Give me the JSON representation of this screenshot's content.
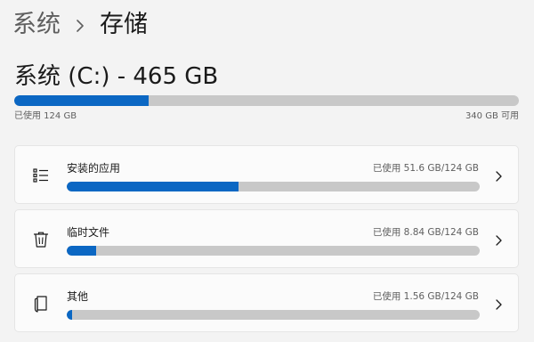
{
  "breadcrumb": {
    "parent": "系统",
    "separator_icon": "chevron-right-icon",
    "current": "存储"
  },
  "drive": {
    "title": "系统 (C:) - 465 GB",
    "used_label": "已使用 124 GB",
    "free_label": "340 GB 可用",
    "used_fraction": 0.267
  },
  "categories": [
    {
      "label": "安装的应用",
      "usage": "已使用 51.6 GB/124 GB",
      "fraction": 0.416,
      "icon": "apps-list-icon"
    },
    {
      "label": "临时文件",
      "usage": "已使用 8.84 GB/124 GB",
      "fraction": 0.071,
      "icon": "trash-icon"
    },
    {
      "label": "其他",
      "usage": "已使用 1.56 GB/124 GB",
      "fraction": 0.013,
      "icon": "documents-icon"
    }
  ],
  "colors": {
    "accent": "#0b67c3",
    "track": "#c8c8c8",
    "background": "#f3f3f3",
    "card": "#fbfbfb"
  }
}
